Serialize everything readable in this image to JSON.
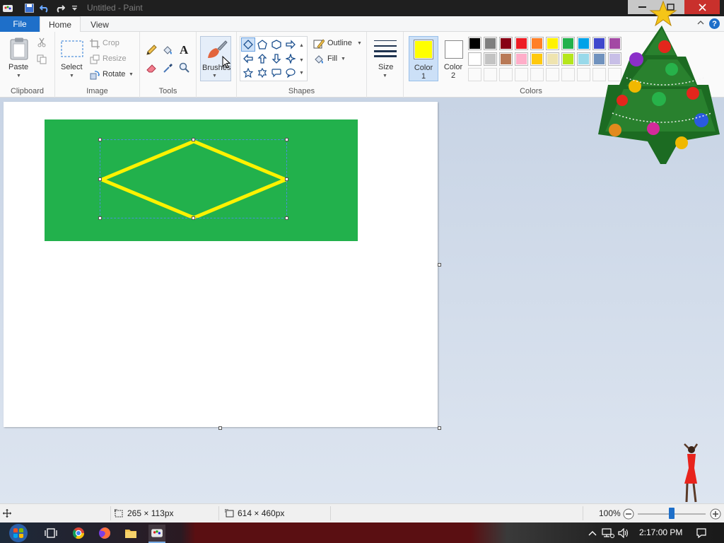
{
  "app": {
    "window_title": "Untitled - Paint"
  },
  "tabs": {
    "file": "File",
    "home": "Home",
    "view": "View"
  },
  "clipboard": {
    "paste_label": "Paste",
    "group_label": "Clipboard"
  },
  "image": {
    "select_label": "Select",
    "crop_label": "Crop",
    "resize_label": "Resize",
    "rotate_label": "Rotate",
    "group_label": "Image"
  },
  "tools": {
    "group_label": "Tools"
  },
  "brushes": {
    "label": "Brushes"
  },
  "shapes": {
    "outline_label": "Outline",
    "fill_label": "Fill",
    "group_label": "Shapes"
  },
  "size": {
    "label": "Size"
  },
  "colors": {
    "color1_label": "Color 1",
    "color2_label": "Color 2",
    "group_label": "Colors",
    "color1_value": "#ffff00",
    "color2_value": "#ffffff",
    "palette_row1": [
      "#000000",
      "#7f7f7f",
      "#880015",
      "#ed1c24",
      "#ff7f27",
      "#fff200",
      "#22b14c",
      "#00a2e8",
      "#3f48cc",
      "#a349a4"
    ],
    "palette_row2": [
      "#ffffff",
      "#c3c3c3",
      "#b97a57",
      "#ffaec9",
      "#ffc90e",
      "#efe4b0",
      "#b5e61d",
      "#99d9ea",
      "#7092be",
      "#c8bfe7"
    ]
  },
  "canvas_drawing": {
    "background_color": "#22b14c",
    "diamond_color": "#fff200"
  },
  "status": {
    "selection_size": "265 × 113px",
    "canvas_size": "614 × 460px",
    "zoom": "100%"
  },
  "taskbar": {
    "clock": "2:17:00 PM"
  }
}
